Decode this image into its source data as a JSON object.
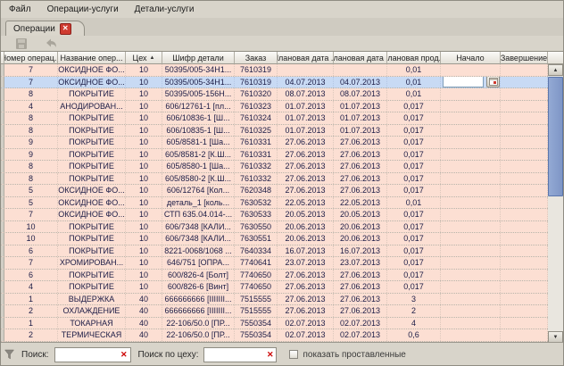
{
  "menu": {
    "items": [
      {
        "id": "file",
        "label": "Файл"
      },
      {
        "id": "operations-services",
        "label": "Операции-услуги"
      },
      {
        "id": "details-services",
        "label": "Детали-услуги"
      }
    ]
  },
  "tab": {
    "label": "Операции",
    "close_icon": "close-icon"
  },
  "toolbar": {
    "buttons": [
      {
        "id": "save",
        "icon": "save-icon"
      },
      {
        "id": "undo",
        "icon": "undo-icon"
      }
    ]
  },
  "table": {
    "columns": [
      {
        "label": "Номер операц..."
      },
      {
        "label": "Название опер..."
      },
      {
        "label": "Цех",
        "sorted": "asc"
      },
      {
        "label": "Шифр детали"
      },
      {
        "label": "Заказ"
      },
      {
        "label": "Плановая дата ..."
      },
      {
        "label": "Плановая дата ..."
      },
      {
        "label": "Плановая прод..."
      },
      {
        "label": "Начало"
      },
      {
        "label": "Завершение"
      }
    ],
    "selected_row_index": 1,
    "editor": {
      "column": "Начало",
      "value": "",
      "button_icon": "calendar-icon"
    },
    "rows": [
      [
        "7",
        "ОКСИДНОЕ ФО...",
        "10",
        "50395/005-34Н1...",
        "7610319",
        "",
        "",
        "0,01",
        "",
        ""
      ],
      [
        "7",
        "ОКСИДНОЕ ФО...",
        "10",
        "50395/005-34Н1...",
        "7610319",
        "04.07.2013",
        "04.07.2013",
        "0,01",
        "",
        ""
      ],
      [
        "8",
        "ПОКРЫТИЕ",
        "10",
        "50395/005-156Н...",
        "7610320",
        "08.07.2013",
        "08.07.2013",
        "0,01",
        "",
        ""
      ],
      [
        "4",
        "АНОДИРОВАН...",
        "10",
        "606/12761-1 [пл...",
        "7610323",
        "01.07.2013",
        "01.07.2013",
        "0,017",
        "",
        ""
      ],
      [
        "8",
        "ПОКРЫТИЕ",
        "10",
        "606/10836-1 [Ш...",
        "7610324",
        "01.07.2013",
        "01.07.2013",
        "0,017",
        "",
        ""
      ],
      [
        "8",
        "ПОКРЫТИЕ",
        "10",
        "606/10835-1 [Ш...",
        "7610325",
        "01.07.2013",
        "01.07.2013",
        "0,017",
        "",
        ""
      ],
      [
        "9",
        "ПОКРЫТИЕ",
        "10",
        "605/8581-1 [Ша...",
        "7610331",
        "27.06.2013",
        "27.06.2013",
        "0,017",
        "",
        ""
      ],
      [
        "9",
        "ПОКРЫТИЕ",
        "10",
        "605/8581-2 [К.Ш...",
        "7610331",
        "27.06.2013",
        "27.06.2013",
        "0,017",
        "",
        ""
      ],
      [
        "8",
        "ПОКРЫТИЕ",
        "10",
        "605/8580-1 [Ша...",
        "7610332",
        "27.06.2013",
        "27.06.2013",
        "0,017",
        "",
        ""
      ],
      [
        "8",
        "ПОКРЫТИЕ",
        "10",
        "605/8580-2 [К.Ш...",
        "7610332",
        "27.06.2013",
        "27.06.2013",
        "0,017",
        "",
        ""
      ],
      [
        "5",
        "ОКСИДНОЕ ФО...",
        "10",
        "606/12764 [Кол...",
        "7620348",
        "27.06.2013",
        "27.06.2013",
        "0,017",
        "",
        ""
      ],
      [
        "5",
        "ОКСИДНОЕ ФО...",
        "10",
        "деталь_1 [коль...",
        "7630532",
        "22.05.2013",
        "22.05.2013",
        "0,01",
        "",
        ""
      ],
      [
        "7",
        "ОКСИДНОЕ ФО...",
        "10",
        "СТП 635.04.014-...",
        "7630533",
        "20.05.2013",
        "20.05.2013",
        "0,017",
        "",
        ""
      ],
      [
        "10",
        "ПОКРЫТИЕ",
        "10",
        "606/7348 [КАЛИ...",
        "7630550",
        "20.06.2013",
        "20.06.2013",
        "0,017",
        "",
        ""
      ],
      [
        "10",
        "ПОКРЫТИЕ",
        "10",
        "606/7348 [КАЛИ...",
        "7630551",
        "20.06.2013",
        "20.06.2013",
        "0,017",
        "",
        ""
      ],
      [
        "6",
        "ПОКРЫТИЕ",
        "10",
        "8221-0068/1068 ...",
        "7640334",
        "16.07.2013",
        "16.07.2013",
        "0,017",
        "",
        ""
      ],
      [
        "7",
        "ХРОМИРОВАН...",
        "10",
        "646/751 [ОПРА...",
        "7740641",
        "23.07.2013",
        "23.07.2013",
        "0,017",
        "",
        ""
      ],
      [
        "6",
        "ПОКРЫТИЕ",
        "10",
        "600/826-4 [Болт]",
        "7740650",
        "27.06.2013",
        "27.06.2013",
        "0,017",
        "",
        ""
      ],
      [
        "4",
        "ПОКРЫТИЕ",
        "10",
        "600/826-6 [Винт]",
        "7740650",
        "27.06.2013",
        "27.06.2013",
        "0,017",
        "",
        ""
      ],
      [
        "1",
        "ВЫДЕРЖКА",
        "40",
        "666666666 [IIIIIII...",
        "7515555",
        "27.06.2013",
        "27.06.2013",
        "3",
        "",
        ""
      ],
      [
        "2",
        "ОХЛАЖДЕНИЕ",
        "40",
        "666666666 [IIIIIII...",
        "7515555",
        "27.06.2013",
        "27.06.2013",
        "2",
        "",
        ""
      ],
      [
        "1",
        "ТОКАРНАЯ",
        "40",
        "22-106/50.0 [ПР...",
        "7550354",
        "02.07.2013",
        "02.07.2013",
        "4",
        "",
        ""
      ],
      [
        "2",
        "ТЕРМИЧЕСКАЯ",
        "40",
        "22-106/50.0 [ПР...",
        "7550354",
        "02.07.2013",
        "02.07.2013",
        "0,6",
        "",
        ""
      ]
    ]
  },
  "filter_bar": {
    "search_label": "Поиск:",
    "search_value": "",
    "shop_search_label": "Поиск по цеху:",
    "shop_search_value": "",
    "checkbox_label": "показать проставленные",
    "checkbox_checked": false
  },
  "colors": {
    "row_pink": "#fcdfd3",
    "row_selected": "#c8daf4",
    "scroll_thumb": "#7e96c6",
    "close_red": "#cf3b30",
    "clear_red": "#cc0000"
  }
}
